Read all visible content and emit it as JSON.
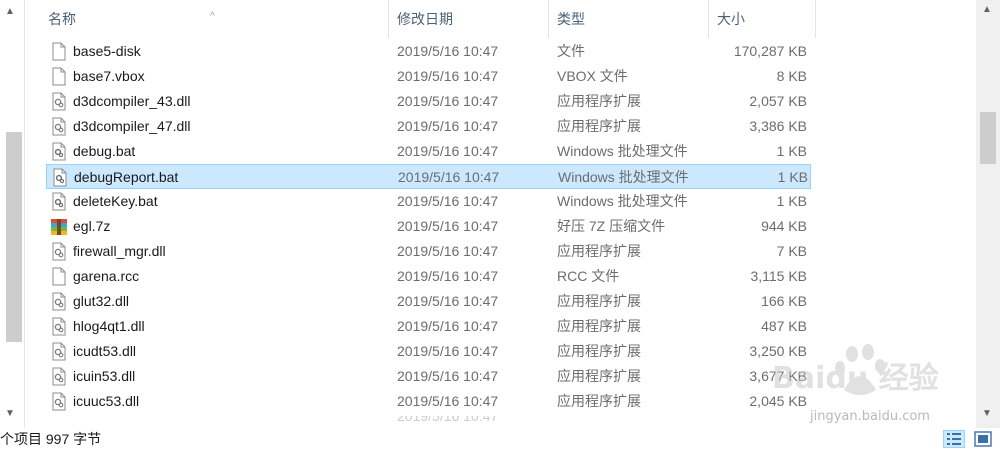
{
  "columns": {
    "name": "名称",
    "date": "修改日期",
    "type": "类型",
    "size": "大小"
  },
  "files": [
    {
      "name": "base5-disk",
      "date": "2019/5/16 10:47",
      "type": "文件",
      "size": "170,287 KB",
      "icon": "blank-file-icon"
    },
    {
      "name": "base7.vbox",
      "date": "2019/5/16 10:47",
      "type": "VBOX 文件",
      "size": "8 KB",
      "icon": "blank-file-icon"
    },
    {
      "name": "d3dcompiler_43.dll",
      "date": "2019/5/16 10:47",
      "type": "应用程序扩展",
      "size": "2,057 KB",
      "icon": "dll-file-icon"
    },
    {
      "name": "d3dcompiler_47.dll",
      "date": "2019/5/16 10:47",
      "type": "应用程序扩展",
      "size": "3,386 KB",
      "icon": "dll-file-icon"
    },
    {
      "name": "debug.bat",
      "date": "2019/5/16 10:47",
      "type": "Windows 批处理文件",
      "size": "1 KB",
      "icon": "bat-file-icon"
    },
    {
      "name": "debugReport.bat",
      "date": "2019/5/16 10:47",
      "type": "Windows 批处理文件",
      "size": "1 KB",
      "icon": "bat-file-icon",
      "selected": true
    },
    {
      "name": "deleteKey.bat",
      "date": "2019/5/16 10:47",
      "type": "Windows 批处理文件",
      "size": "1 KB",
      "icon": "bat-file-icon"
    },
    {
      "name": "egl.7z",
      "date": "2019/5/16 10:47",
      "type": "好压 7Z 压缩文件",
      "size": "944 KB",
      "icon": "archive-file-icon"
    },
    {
      "name": "firewall_mgr.dll",
      "date": "2019/5/16 10:47",
      "type": "应用程序扩展",
      "size": "7 KB",
      "icon": "dll-file-icon"
    },
    {
      "name": "garena.rcc",
      "date": "2019/5/16 10:47",
      "type": "RCC 文件",
      "size": "3,115 KB",
      "icon": "blank-file-icon"
    },
    {
      "name": "glut32.dll",
      "date": "2019/5/16 10:47",
      "type": "应用程序扩展",
      "size": "166 KB",
      "icon": "dll-file-icon"
    },
    {
      "name": "hlog4qt1.dll",
      "date": "2019/5/16 10:47",
      "type": "应用程序扩展",
      "size": "487 KB",
      "icon": "dll-file-icon"
    },
    {
      "name": "icudt53.dll",
      "date": "2019/5/16 10:47",
      "type": "应用程序扩展",
      "size": "3,250 KB",
      "icon": "dll-file-icon"
    },
    {
      "name": "icuin53.dll",
      "date": "2019/5/16 10:47",
      "type": "应用程序扩展",
      "size": "3,677 KB",
      "icon": "dll-file-icon"
    },
    {
      "name": "icuuc53.dll",
      "date": "2019/5/16 10:47",
      "type": "应用程序扩展",
      "size": "2,045 KB",
      "icon": "dll-file-icon"
    }
  ],
  "status": {
    "text": "个项目  997 字节"
  },
  "watermark": {
    "brand": "Baidu 经验",
    "url": "jingyan.baidu.com"
  },
  "colors": {
    "selection_bg": "#cce8ff",
    "selection_border": "#99d1ff",
    "header_text": "#4c607a"
  }
}
